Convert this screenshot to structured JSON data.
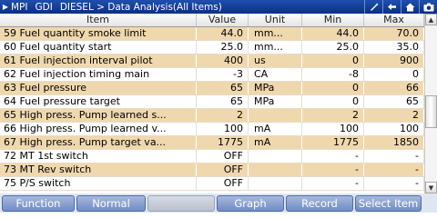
{
  "header": {
    "breadcrumb": [
      "MPI",
      "GDI",
      "DIESEL > Data Analysis(All Items)"
    ],
    "icons": [
      "pen-icon",
      "back-arrow-icon",
      "home-icon",
      "camera-icon"
    ]
  },
  "table": {
    "columns": [
      "Item",
      "Value",
      "Unit",
      "Min",
      "Max"
    ],
    "rows": [
      {
        "item": "59 Fuel quantity smoke limit",
        "value": "44.0",
        "unit": "mm...",
        "min": "44.0",
        "max": "70.0"
      },
      {
        "item": "60 Fuel quantity start",
        "value": "25.0",
        "unit": "mm...",
        "min": "25.0",
        "max": "35.0"
      },
      {
        "item": "61 Fuel injection interval pilot",
        "value": "400",
        "unit": "us",
        "min": "0",
        "max": "900"
      },
      {
        "item": "62 Fuel injection timing main",
        "value": "-3",
        "unit": "CA",
        "min": "-8",
        "max": "0"
      },
      {
        "item": "63 Fuel pressure",
        "value": "65",
        "unit": "MPa",
        "min": "0",
        "max": "66"
      },
      {
        "item": "64 Fuel pressure target",
        "value": "65",
        "unit": "MPa",
        "min": "0",
        "max": "65"
      },
      {
        "item": "65 High press. Pump learned s...",
        "value": "2",
        "unit": "",
        "min": "2",
        "max": "2"
      },
      {
        "item": "66 High press. Pump learned v...",
        "value": "100",
        "unit": "mA",
        "min": "100",
        "max": "100"
      },
      {
        "item": "67 High press. Pump target va...",
        "value": "1775",
        "unit": "mA",
        "min": "1775",
        "max": "1850"
      },
      {
        "item": "72 MT 1st switch",
        "value": "OFF",
        "unit": "",
        "min": "-",
        "max": "-"
      },
      {
        "item": "73 MT Rev switch",
        "value": "OFF",
        "unit": "",
        "min": "-",
        "max": "-"
      },
      {
        "item": "75 P/S switch",
        "value": "OFF",
        "unit": "",
        "min": "-",
        "max": "-"
      }
    ]
  },
  "footer": {
    "buttons": [
      "Function",
      "Normal",
      "",
      "Graph",
      "Record",
      "Select Item"
    ]
  },
  "colors": {
    "titlebar": "#0a2f86",
    "row_highlight": "#f0d8ae",
    "button": "#6f8cc6"
  }
}
